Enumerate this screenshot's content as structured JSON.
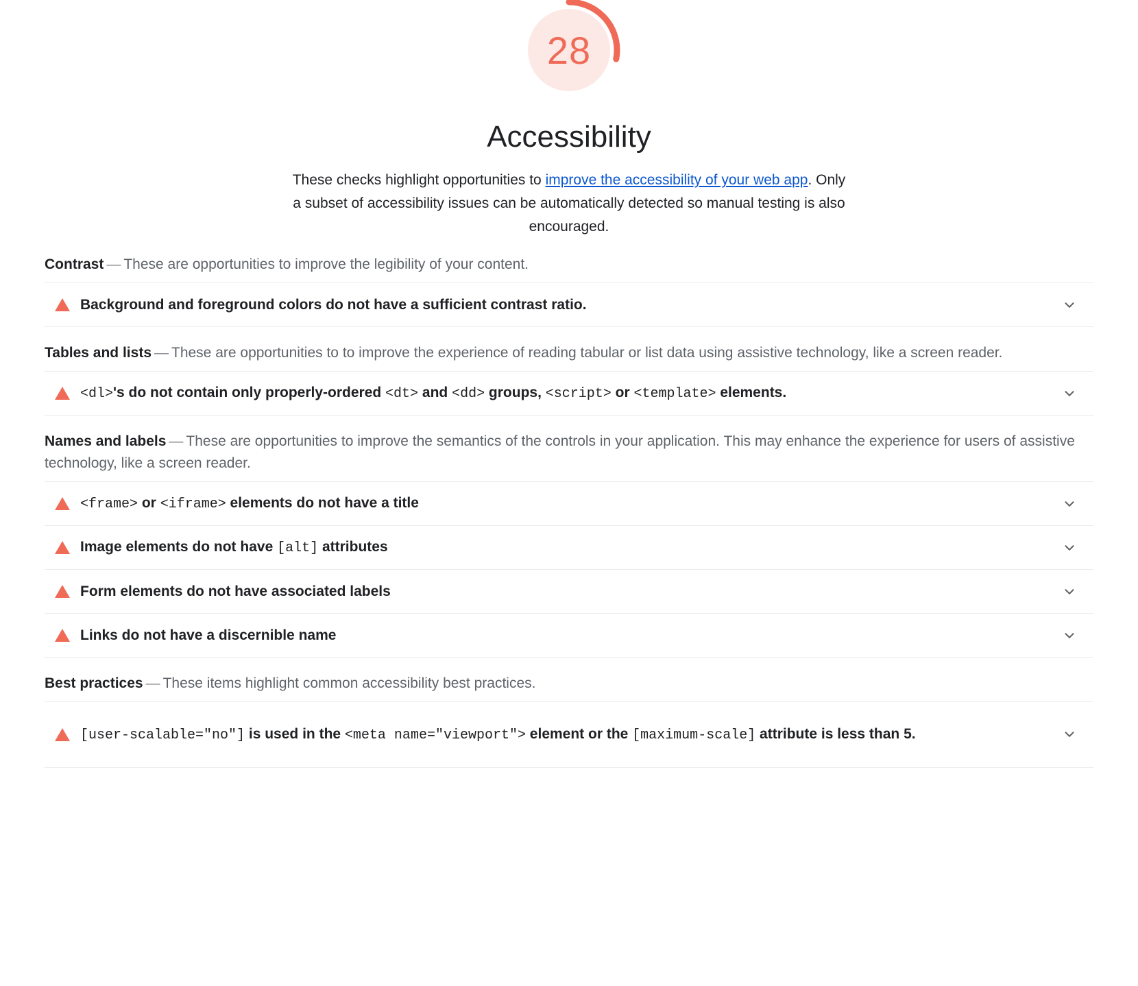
{
  "gauge": {
    "score": "28",
    "score_color": "#ef6b57",
    "track_color": "#fce9e6",
    "percent": 28,
    "icon": "score-gauge-arc"
  },
  "category": {
    "title": "Accessibility",
    "description_prefix": "These checks highlight opportunities to ",
    "description_link": "improve the accessibility of your web app",
    "description_suffix": ". Only a subset of accessibility issues can be automatically detected so manual testing is also encouraged."
  },
  "groups": [
    {
      "title": "Contrast",
      "dash": "—",
      "description": "These are opportunities to improve the legibility of your content.",
      "audits": [
        {
          "icon": "warning-triangle-icon",
          "expand_icon": "chevron-down-icon",
          "parts": [
            {
              "t": "text",
              "v": "Background and foreground colors do not have a sufficient contrast ratio."
            }
          ]
        }
      ]
    },
    {
      "title": "Tables and lists",
      "dash": "—",
      "description": "These are opportunities to to improve the experience of reading tabular or list data using assistive technology, like a screen reader.",
      "audits": [
        {
          "icon": "warning-triangle-icon",
          "expand_icon": "chevron-down-icon",
          "parts": [
            {
              "t": "code",
              "v": "<dl>"
            },
            {
              "t": "text",
              "v": "'s do not contain only properly-ordered "
            },
            {
              "t": "code",
              "v": "<dt>"
            },
            {
              "t": "text",
              "v": " and "
            },
            {
              "t": "code",
              "v": "<dd>"
            },
            {
              "t": "text",
              "v": " groups, "
            },
            {
              "t": "code",
              "v": "<script>"
            },
            {
              "t": "text",
              "v": " or "
            },
            {
              "t": "code",
              "v": "<template>"
            },
            {
              "t": "text",
              "v": " elements."
            }
          ]
        }
      ]
    },
    {
      "title": "Names and labels",
      "dash": "—",
      "description": "These are opportunities to improve the semantics of the controls in your application. This may enhance the experience for users of assistive technology, like a screen reader.",
      "audits": [
        {
          "icon": "warning-triangle-icon",
          "expand_icon": "chevron-down-icon",
          "parts": [
            {
              "t": "code",
              "v": "<frame>"
            },
            {
              "t": "text",
              "v": " or "
            },
            {
              "t": "code",
              "v": "<iframe>"
            },
            {
              "t": "text",
              "v": " elements do not have a title"
            }
          ]
        },
        {
          "icon": "warning-triangle-icon",
          "expand_icon": "chevron-down-icon",
          "parts": [
            {
              "t": "text",
              "v": "Image elements do not have "
            },
            {
              "t": "code",
              "v": "[alt]"
            },
            {
              "t": "text",
              "v": " attributes"
            }
          ]
        },
        {
          "icon": "warning-triangle-icon",
          "expand_icon": "chevron-down-icon",
          "parts": [
            {
              "t": "text",
              "v": "Form elements do not have associated labels"
            }
          ]
        },
        {
          "icon": "warning-triangle-icon",
          "expand_icon": "chevron-down-icon",
          "parts": [
            {
              "t": "text",
              "v": "Links do not have a discernible name"
            }
          ]
        }
      ]
    },
    {
      "title": "Best practices",
      "dash": "—",
      "description": "These items highlight common accessibility best practices.",
      "audits": [
        {
          "icon": "warning-triangle-icon",
          "expand_icon": "chevron-down-icon",
          "tall": true,
          "parts": [
            {
              "t": "code",
              "v": "[user-scalable=\"no\"]"
            },
            {
              "t": "text",
              "v": " is used in the "
            },
            {
              "t": "code",
              "v": "<meta name=\"viewport\">"
            },
            {
              "t": "text",
              "v": " element or the "
            },
            {
              "t": "code",
              "v": "[maximum-scale]"
            },
            {
              "t": "text",
              "v": " attribute is less than 5."
            }
          ]
        }
      ]
    }
  ]
}
